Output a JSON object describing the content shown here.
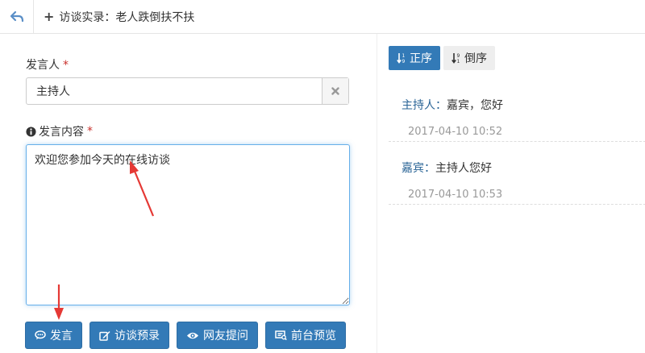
{
  "header": {
    "title": "访谈实录：老人跌倒扶不扶"
  },
  "form": {
    "speaker_label": "发言人",
    "speaker_value": "主持人",
    "content_label": "发言内容",
    "content_value": "欢迎您参加今天的在线访谈",
    "required_mark": "*"
  },
  "actions": {
    "speak": "发言",
    "record": "访谈预录",
    "questions": "网友提问",
    "preview": "前台预览"
  },
  "sort": {
    "asc": "正序",
    "desc": "倒序"
  },
  "messages": [
    {
      "speaker": "主持人：",
      "text": "嘉宾，您好",
      "time": "2017-04-10 10:52"
    },
    {
      "speaker": "嘉宾：",
      "text": "主持人您好",
      "time": "2017-04-10 10:53"
    }
  ],
  "colors": {
    "primary": "#337ab7",
    "required": "#c9302c",
    "focus": "#66afe9",
    "annotation_arrow": "#e53935"
  },
  "icons": [
    "back-arrow-icon",
    "plus-icon",
    "clear-icon",
    "info-icon",
    "comment-icon",
    "edit-icon",
    "eye-icon",
    "preview-icon",
    "sort-asc-icon",
    "sort-desc-icon"
  ]
}
